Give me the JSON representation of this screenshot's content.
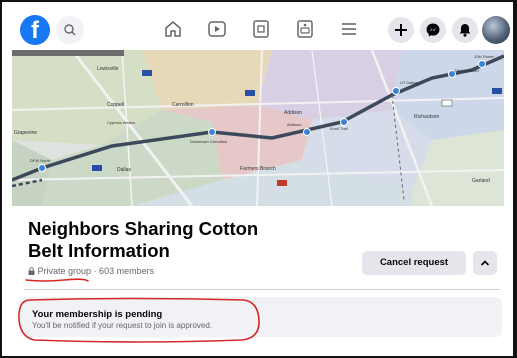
{
  "group": {
    "title": "Neighbors Sharing Cotton Belt Information",
    "privacy": "Private group",
    "members": "· 603 members",
    "cancel_label": "Cancel request"
  },
  "pending": {
    "title": "Your membership is pending",
    "subtitle": "You'll be notified if your request to join is approved."
  },
  "map_labels": {
    "lewisville": "Lewisville",
    "coppell": "Coppell",
    "carrollton": "Carrollton",
    "addison": "Addison",
    "richardson": "Richardson",
    "grapevine": "Grapevine",
    "cypress_waters": "Cypress Waters",
    "downtown_carrollton": "Downtown Carrollton",
    "farmers_branch": "Farmers Branch",
    "dallas": "Dallas",
    "garland": "Garland",
    "dfw_north": "DFW North",
    "knoll_trail": "Knoll Trail",
    "ut_dallas": "UT Dallas",
    "city_line": "CityLine/Bush",
    "twelfth_street": "12th Street",
    "addison_station": "Addison"
  },
  "colors": {
    "brand": "#1877f2",
    "rail_line": "#3d4a5c",
    "station": "#3b82d6",
    "annotation": "#d4292a"
  },
  "icons": [
    "facebook-logo-icon",
    "search-icon",
    "home-icon",
    "video-icon",
    "marketplace-icon",
    "gaming-icon",
    "menu-icon",
    "plus-icon",
    "messenger-icon",
    "bell-icon",
    "lock-icon",
    "chevron-up-icon"
  ]
}
